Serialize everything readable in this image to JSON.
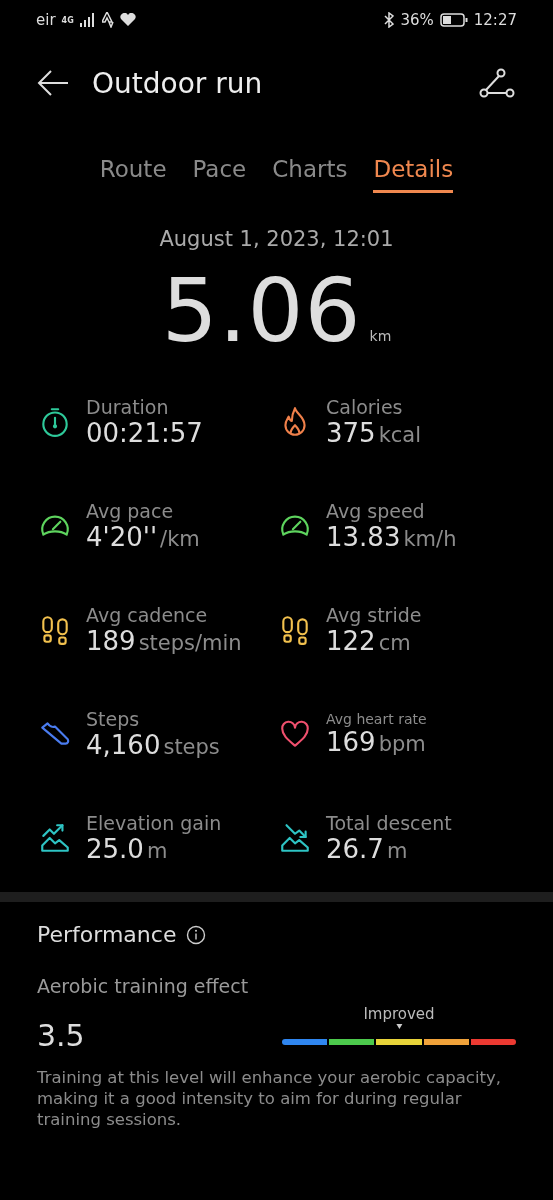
{
  "status_bar": {
    "carrier": "eir",
    "network": "4G",
    "battery": "36%",
    "time": "12:27"
  },
  "header": {
    "title": "Outdoor run"
  },
  "tabs": [
    {
      "label": "Route",
      "selected": false
    },
    {
      "label": "Pace",
      "selected": false
    },
    {
      "label": "Charts",
      "selected": false
    },
    {
      "label": "Details",
      "selected": true
    }
  ],
  "date": "August 1, 2023, 12:01",
  "distance": {
    "value": "5.06",
    "unit": "km"
  },
  "stats": [
    {
      "kind": "duration",
      "label": "Duration",
      "value": "00:21:57",
      "color": "#2ec99a",
      "small_label": false
    },
    {
      "kind": "calories",
      "label": "Calories",
      "value": "375",
      "unit": "kcal",
      "color": "#f0804a",
      "small_label": false
    },
    {
      "kind": "pace",
      "label": "Avg pace",
      "value": "4'20''",
      "unit": "/km",
      "color": "#5ed45e",
      "small_label": false
    },
    {
      "kind": "speed",
      "label": "Avg speed",
      "value": "13.83",
      "unit": "km/h",
      "color": "#5ed45e",
      "small_label": false
    },
    {
      "kind": "cadence",
      "label": "Avg cadence",
      "value": "189",
      "unit": "steps/min",
      "color": "#f2c14e",
      "small_label": false
    },
    {
      "kind": "stride",
      "label": "Avg stride",
      "value": "122",
      "unit": "cm",
      "color": "#f2c14e",
      "small_label": false
    },
    {
      "kind": "steps",
      "label": "Steps",
      "value": "4,160",
      "unit": "steps",
      "color": "#4a7cf0",
      "small_label": false
    },
    {
      "kind": "heart",
      "label": "Avg heart rate",
      "value": "169",
      "unit": "bpm",
      "color": "#f0506e",
      "small_label": true
    },
    {
      "kind": "ascent",
      "label": "Elevation gain",
      "value": "25.0",
      "unit": "m",
      "color": "#2ec4c4",
      "small_label": false
    },
    {
      "kind": "descent",
      "label": "Total descent",
      "value": "26.7",
      "unit": "m",
      "color": "#2ec4c4",
      "small_label": false
    }
  ],
  "performance": {
    "title": "Performance",
    "metric": "Aerobic training effect",
    "score": "3.5",
    "rating": "Improved",
    "level": 0.5,
    "segments": [
      {
        "color": "#2f86f0"
      },
      {
        "color": "#4cc94c"
      },
      {
        "color": "#e8d43a"
      },
      {
        "color": "#f0a23a"
      },
      {
        "color": "#ec3a32"
      }
    ],
    "description": "Training at this level will enhance your aerobic capacity, making it a good intensity to aim for during regular training sessions."
  }
}
